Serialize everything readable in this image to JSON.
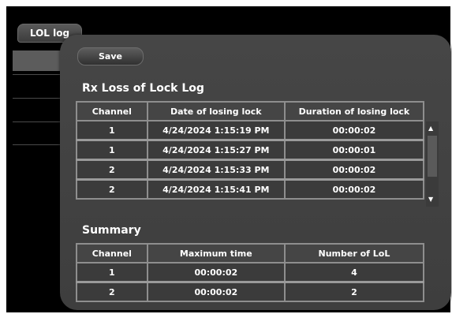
{
  "tab": {
    "label": "LOL log"
  },
  "toolbar": {
    "save_label": "Save"
  },
  "log": {
    "title": "Rx Loss of Lock Log",
    "columns": [
      "Channel",
      "Date of losing lock",
      "Duration of losing lock"
    ],
    "rows": [
      [
        "1",
        "4/24/2024 1:15:19 PM",
        "00:00:02"
      ],
      [
        "1",
        "4/24/2024 1:15:27 PM",
        "00:00:01"
      ],
      [
        "2",
        "4/24/2024 1:15:33 PM",
        "00:00:02"
      ],
      [
        "2",
        "4/24/2024 1:15:41 PM",
        "00:00:02"
      ]
    ]
  },
  "summary": {
    "title": "Summary",
    "columns": [
      "Channel",
      "Maximum time",
      "Number of LoL"
    ],
    "rows": [
      [
        "1",
        "00:00:02",
        "4"
      ],
      [
        "2",
        "00:00:02",
        "2"
      ]
    ]
  },
  "icons": {
    "scroll_up": "up-arrow-icon",
    "scroll_down": "down-arrow-icon"
  },
  "colors": {
    "background": "#000000",
    "panel": "#444444",
    "grid": "#8e8e8e",
    "text": "#ffffff"
  }
}
